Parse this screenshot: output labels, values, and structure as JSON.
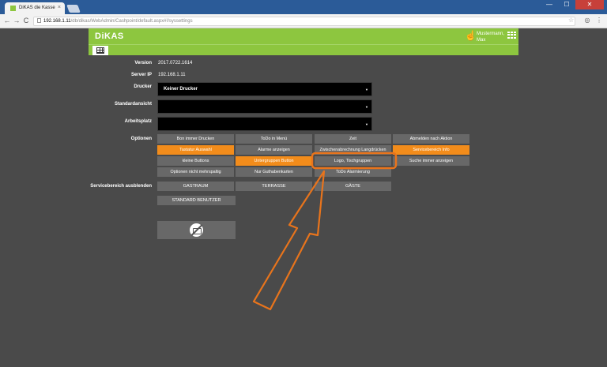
{
  "browser": {
    "tab_title": "DiKAS die Kasse",
    "tab_close": "×",
    "win_min": "—",
    "win_max": "☐",
    "win_close": "✕",
    "back": "←",
    "forward": "→",
    "reload": "C",
    "url_host": "192.168.1.11",
    "url_path": "/db/dikas/WebAdmin/Cashpoint/default.aspx#!/syssettings"
  },
  "header": {
    "logo": "DiKAS",
    "user_name_line1": "Mustermann,",
    "user_name_line2": "Max",
    "accent": "#8dc63f"
  },
  "settings": {
    "version_label": "Version",
    "version_value": "2017.0722.1614",
    "server_label": "Server IP",
    "server_value": "192.168.1.11",
    "printer_label": "Drucker",
    "printer_value": "Keiner Drucker",
    "default_view_label": "Standardansicht",
    "default_view_value": "",
    "workstation_label": "Arbeitsplatz",
    "workstation_value": "",
    "options_label": "Optionen",
    "hide_service_label": "Servicebereich ausblenden"
  },
  "options": [
    {
      "label": "Bon immer Drucken",
      "active": false
    },
    {
      "label": "ToDo in Menü",
      "active": false
    },
    {
      "label": "Zeit",
      "active": false
    },
    {
      "label": "Abmelden nach Aktion",
      "active": false
    },
    {
      "label": "Tastatur Auswahl",
      "active": true
    },
    {
      "label": "Alarme anzeigen",
      "active": false
    },
    {
      "label": "Zwischenabrechnung Langdrücken",
      "active": false
    },
    {
      "label": "Servicebereich Info",
      "active": true
    },
    {
      "label": "kleine Buttons",
      "active": false
    },
    {
      "label": "Untergruppen Button",
      "active": true
    },
    {
      "label": "Logo, Tischgruppen",
      "active": false
    },
    {
      "label": "Suche immer anzeigen",
      "active": false
    },
    {
      "label": "Optionen nicht mehrspaltig",
      "active": false
    },
    {
      "label": "Nur Guthabenkarten",
      "active": false
    },
    {
      "label": "ToDo Alarmierung",
      "active": false
    }
  ],
  "service_areas": [
    "GASTRAUM",
    "TERRASSE",
    "GÄSTE"
  ],
  "standard_user_button": "STANDARD BENUTZER",
  "colors": {
    "active_option": "#f28c1b",
    "inactive_option": "#686868",
    "annotation": "#e8741c"
  }
}
